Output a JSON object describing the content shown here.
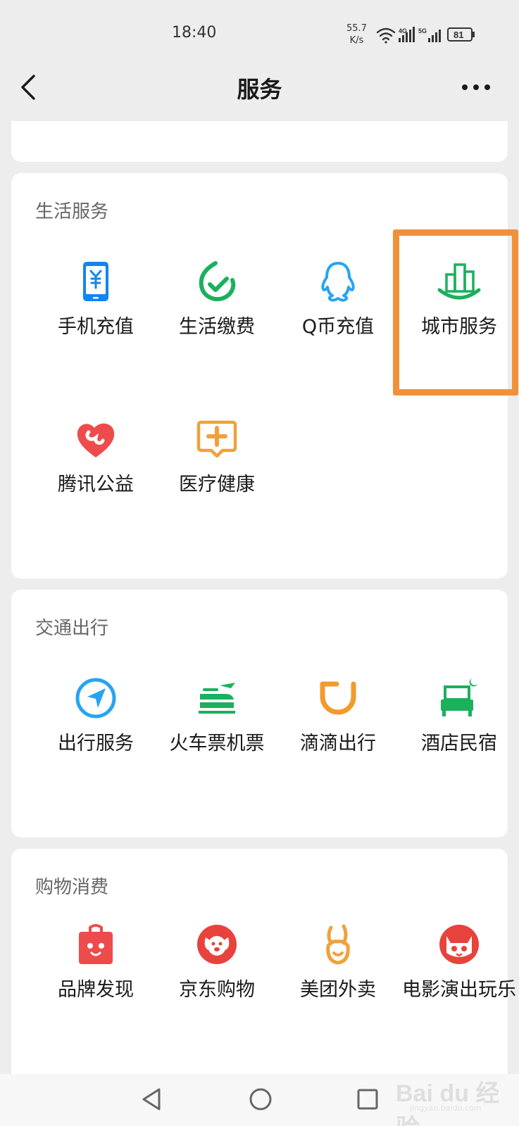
{
  "status_bar": {
    "time": "18:40",
    "net_speed_value": "55.7",
    "net_speed_unit": "K/s",
    "signal_1": "4G",
    "signal_2": "5G",
    "battery": "81"
  },
  "nav": {
    "title": "服务",
    "back_icon": "chevron-left-icon",
    "more_icon": "more-dots-icon"
  },
  "sections": [
    {
      "title": "生活服务",
      "items": [
        {
          "label": "手机充值",
          "icon": "phone-recharge-icon",
          "color": "#1485ee"
        },
        {
          "label": "生活缴费",
          "icon": "bill-payment-icon",
          "color": "#1bb05c"
        },
        {
          "label": "Q币充值",
          "icon": "qq-penguin-icon",
          "color": "#26a4f2"
        },
        {
          "label": "城市服务",
          "icon": "city-buildings-icon",
          "color": "#1bb05c"
        },
        {
          "label": "腾讯公益",
          "icon": "charity-heart-icon",
          "color": "#ee4c4c"
        },
        {
          "label": "医疗健康",
          "icon": "medical-cross-icon",
          "color": "#f0a13c"
        }
      ]
    },
    {
      "title": "交通出行",
      "items": [
        {
          "label": "出行服务",
          "icon": "navigation-arrow-icon",
          "color": "#26a4f2"
        },
        {
          "label": "火车票机票",
          "icon": "train-plane-icon",
          "color": "#1bb05c"
        },
        {
          "label": "滴滴出行",
          "icon": "didi-icon",
          "color": "#f39a2c"
        },
        {
          "label": "酒店民宿",
          "icon": "hotel-bed-icon",
          "color": "#1bb05c"
        }
      ]
    },
    {
      "title": "购物消费",
      "items": [
        {
          "label": "品牌发现",
          "icon": "brand-bag-icon",
          "color": "#ee4c4c"
        },
        {
          "label": "京东购物",
          "icon": "jd-dog-icon",
          "color": "#e8423c"
        },
        {
          "label": "美团外卖",
          "icon": "meituan-rabbit-icon",
          "color": "#f0a13c"
        },
        {
          "label": "电影演出玩乐",
          "icon": "maoyan-cat-icon",
          "color": "#e8423c"
        }
      ]
    }
  ],
  "highlight": {
    "target": "城市服务",
    "color": "#f0913a"
  },
  "watermark": {
    "text": "Bai du 经验",
    "sub": "jingyan.baidu.com"
  },
  "system_nav": {
    "back_icon": "triangle-back-icon",
    "home_icon": "circle-home-icon",
    "recent_icon": "square-recent-icon"
  }
}
